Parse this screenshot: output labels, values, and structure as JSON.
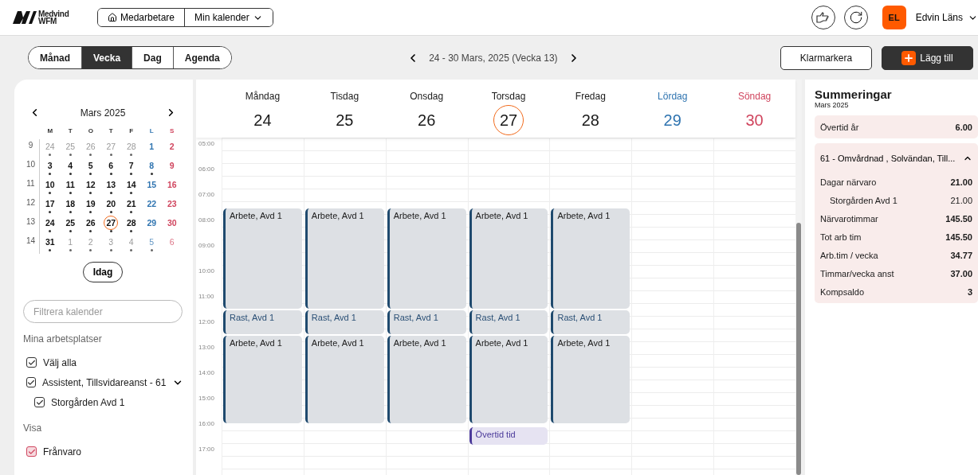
{
  "header": {
    "logo": {
      "top": "Medvind",
      "bottom": "WFM"
    },
    "nav": [
      {
        "label": "Medarbetare",
        "kind": "home"
      },
      {
        "label": "Min kalender",
        "kind": "dropdown"
      }
    ],
    "user": {
      "initials": "EL",
      "name": "Edvin Läns"
    }
  },
  "toolbar": {
    "views": [
      {
        "label": "Månad",
        "selected": false
      },
      {
        "label": "Vecka",
        "selected": true
      },
      {
        "label": "Dag",
        "selected": false
      },
      {
        "label": "Agenda",
        "selected": false
      }
    ],
    "range": "24 - 30 Mars, 2025 (Vecka 13)",
    "buttons": [
      {
        "label": "Klarmarkera",
        "kind": "outline"
      },
      {
        "label": "Lägg till",
        "kind": "primary"
      }
    ]
  },
  "mini_calendar": {
    "title": "Mars 2025",
    "weekdays": [
      "M",
      "T",
      "O",
      "T",
      "F",
      "L",
      "S"
    ],
    "weeks": [
      {
        "number": "9",
        "days": [
          {
            "label": "24",
            "outside": true,
            "has_events": true,
            "today": false
          },
          {
            "label": "25",
            "outside": true,
            "has_events": true,
            "today": false
          },
          {
            "label": "26",
            "outside": true,
            "has_events": true,
            "today": false
          },
          {
            "label": "27",
            "outside": true,
            "has_events": true,
            "today": false
          },
          {
            "label": "28",
            "outside": true,
            "has_events": true,
            "today": false
          },
          {
            "label": "1",
            "outside": false,
            "has_events": false,
            "today": false
          },
          {
            "label": "2",
            "outside": false,
            "has_events": false,
            "today": false
          }
        ]
      },
      {
        "number": "10",
        "days": [
          {
            "label": "3",
            "outside": false,
            "has_events": true,
            "today": false
          },
          {
            "label": "4",
            "outside": false,
            "has_events": true,
            "today": false
          },
          {
            "label": "5",
            "outside": false,
            "has_events": true,
            "today": false
          },
          {
            "label": "6",
            "outside": false,
            "has_events": true,
            "today": false
          },
          {
            "label": "7",
            "outside": false,
            "has_events": true,
            "today": false
          },
          {
            "label": "8",
            "outside": false,
            "has_events": true,
            "today": false
          },
          {
            "label": "9",
            "outside": false,
            "has_events": false,
            "today": false
          }
        ]
      },
      {
        "number": "11",
        "days": [
          {
            "label": "10",
            "outside": false,
            "has_events": true,
            "today": false
          },
          {
            "label": "11",
            "outside": false,
            "has_events": true,
            "today": false
          },
          {
            "label": "12",
            "outside": false,
            "has_events": true,
            "today": false
          },
          {
            "label": "13",
            "outside": false,
            "has_events": true,
            "today": false
          },
          {
            "label": "14",
            "outside": false,
            "has_events": true,
            "today": false
          },
          {
            "label": "15",
            "outside": false,
            "has_events": false,
            "today": false
          },
          {
            "label": "16",
            "outside": false,
            "has_events": false,
            "today": false
          }
        ]
      },
      {
        "number": "12",
        "days": [
          {
            "label": "17",
            "outside": false,
            "has_events": true,
            "today": false
          },
          {
            "label": "18",
            "outside": false,
            "has_events": true,
            "today": false
          },
          {
            "label": "19",
            "outside": false,
            "has_events": true,
            "today": false
          },
          {
            "label": "20",
            "outside": false,
            "has_events": true,
            "today": false
          },
          {
            "label": "21",
            "outside": false,
            "has_events": true,
            "today": false
          },
          {
            "label": "22",
            "outside": false,
            "has_events": false,
            "today": false
          },
          {
            "label": "23",
            "outside": false,
            "has_events": false,
            "today": false
          }
        ]
      },
      {
        "number": "13",
        "days": [
          {
            "label": "24",
            "outside": false,
            "has_events": true,
            "today": false
          },
          {
            "label": "25",
            "outside": false,
            "has_events": true,
            "today": false
          },
          {
            "label": "26",
            "outside": false,
            "has_events": true,
            "today": false
          },
          {
            "label": "27",
            "outside": false,
            "has_events": true,
            "today": true
          },
          {
            "label": "28",
            "outside": false,
            "has_events": true,
            "today": false
          },
          {
            "label": "29",
            "outside": false,
            "has_events": false,
            "today": false
          },
          {
            "label": "30",
            "outside": false,
            "has_events": false,
            "today": false
          }
        ]
      },
      {
        "number": "14",
        "days": [
          {
            "label": "31",
            "outside": false,
            "has_events": true,
            "today": false
          },
          {
            "label": "1",
            "outside": true,
            "has_events": true,
            "today": false
          },
          {
            "label": "2",
            "outside": true,
            "has_events": true,
            "today": false
          },
          {
            "label": "3",
            "outside": true,
            "has_events": true,
            "today": false
          },
          {
            "label": "4",
            "outside": true,
            "has_events": true,
            "today": false
          },
          {
            "label": "5",
            "outside": true,
            "has_events": true,
            "today": false
          },
          {
            "label": "6",
            "outside": true,
            "has_events": false,
            "today": false
          }
        ]
      }
    ],
    "today_button": "Idag"
  },
  "filter": {
    "placeholder": "Filtrera kalender"
  },
  "workplaces": {
    "title": "Mina arbetsplatser",
    "items": [
      {
        "label": "Välj alla",
        "checked": true
      },
      {
        "label": "Assistent, Tillsvidareanst - 61",
        "checked": true,
        "expanded": true,
        "children": [
          {
            "label": "Storgården Avd 1",
            "checked": true
          }
        ]
      }
    ]
  },
  "show": {
    "title": "Visa",
    "items": [
      {
        "label": "Frånvaro",
        "checked": true,
        "color": "#d0455e"
      }
    ]
  },
  "week": {
    "days": [
      {
        "name": "Måndag",
        "date": "24",
        "kind": "weekday",
        "today": false,
        "events": [
          {
            "title": "Arbete, Avd 1",
            "kind": "work"
          },
          {
            "title": "Rast, Avd 1",
            "kind": "break"
          },
          {
            "title": "Arbete, Avd 1",
            "kind": "work"
          }
        ]
      },
      {
        "name": "Tisdag",
        "date": "25",
        "kind": "weekday",
        "today": false,
        "events": [
          {
            "title": "Arbete, Avd 1",
            "kind": "work"
          },
          {
            "title": "Rast, Avd 1",
            "kind": "break"
          },
          {
            "title": "Arbete, Avd 1",
            "kind": "work"
          }
        ]
      },
      {
        "name": "Onsdag",
        "date": "26",
        "kind": "weekday",
        "today": false,
        "events": [
          {
            "title": "Arbete, Avd 1",
            "kind": "work"
          },
          {
            "title": "Rast, Avd 1",
            "kind": "break"
          },
          {
            "title": "Arbete, Avd 1",
            "kind": "work"
          }
        ]
      },
      {
        "name": "Torsdag",
        "date": "27",
        "kind": "weekday",
        "today": true,
        "events": [
          {
            "title": "Arbete, Avd 1",
            "kind": "work"
          },
          {
            "title": "Rast, Avd 1",
            "kind": "break"
          },
          {
            "title": "Arbete, Avd 1",
            "kind": "work"
          },
          {
            "title": "Övertid tid",
            "kind": "overtime"
          }
        ]
      },
      {
        "name": "Fredag",
        "date": "28",
        "kind": "weekday",
        "today": false,
        "events": [
          {
            "title": "Arbete, Avd 1",
            "kind": "work"
          },
          {
            "title": "Rast, Avd 1",
            "kind": "break"
          },
          {
            "title": "Arbete, Avd 1",
            "kind": "work"
          }
        ]
      },
      {
        "name": "Lördag",
        "date": "29",
        "kind": "saturday",
        "today": false
      },
      {
        "name": "Söndag",
        "date": "30",
        "kind": "sunday",
        "today": false
      }
    ],
    "hours": [
      "05:00",
      "06:00",
      "07:00",
      "08:00",
      "09:00",
      "10:00",
      "11:00",
      "12:00",
      "13:00",
      "14:00",
      "15:00",
      "16:00",
      "17:00"
    ]
  },
  "summary": {
    "title": "Summeringar",
    "subtitle": "Mars 2025",
    "overtime": {
      "label": "Övertid år",
      "value": "6.00"
    },
    "group": {
      "title": "61 - Omvårdnad , Solvändan, Till...",
      "expanded": true,
      "rows": [
        {
          "label": "Dagar närvaro",
          "value": "21.00",
          "kind": "main"
        },
        {
          "label": "Storgården Avd 1",
          "value": "21.00",
          "kind": "sub"
        },
        {
          "label": "Närvarotimmar",
          "value": "145.50",
          "kind": "main"
        },
        {
          "label": "Tot arb tim",
          "value": "145.50",
          "kind": "main"
        },
        {
          "label": "Arb.tim / vecka",
          "value": "34.77",
          "kind": "main"
        },
        {
          "label": "Timmar/vecka anst",
          "value": "37.00",
          "kind": "main"
        },
        {
          "label": "Kompsaldo",
          "value": "3",
          "kind": "main"
        }
      ]
    }
  }
}
